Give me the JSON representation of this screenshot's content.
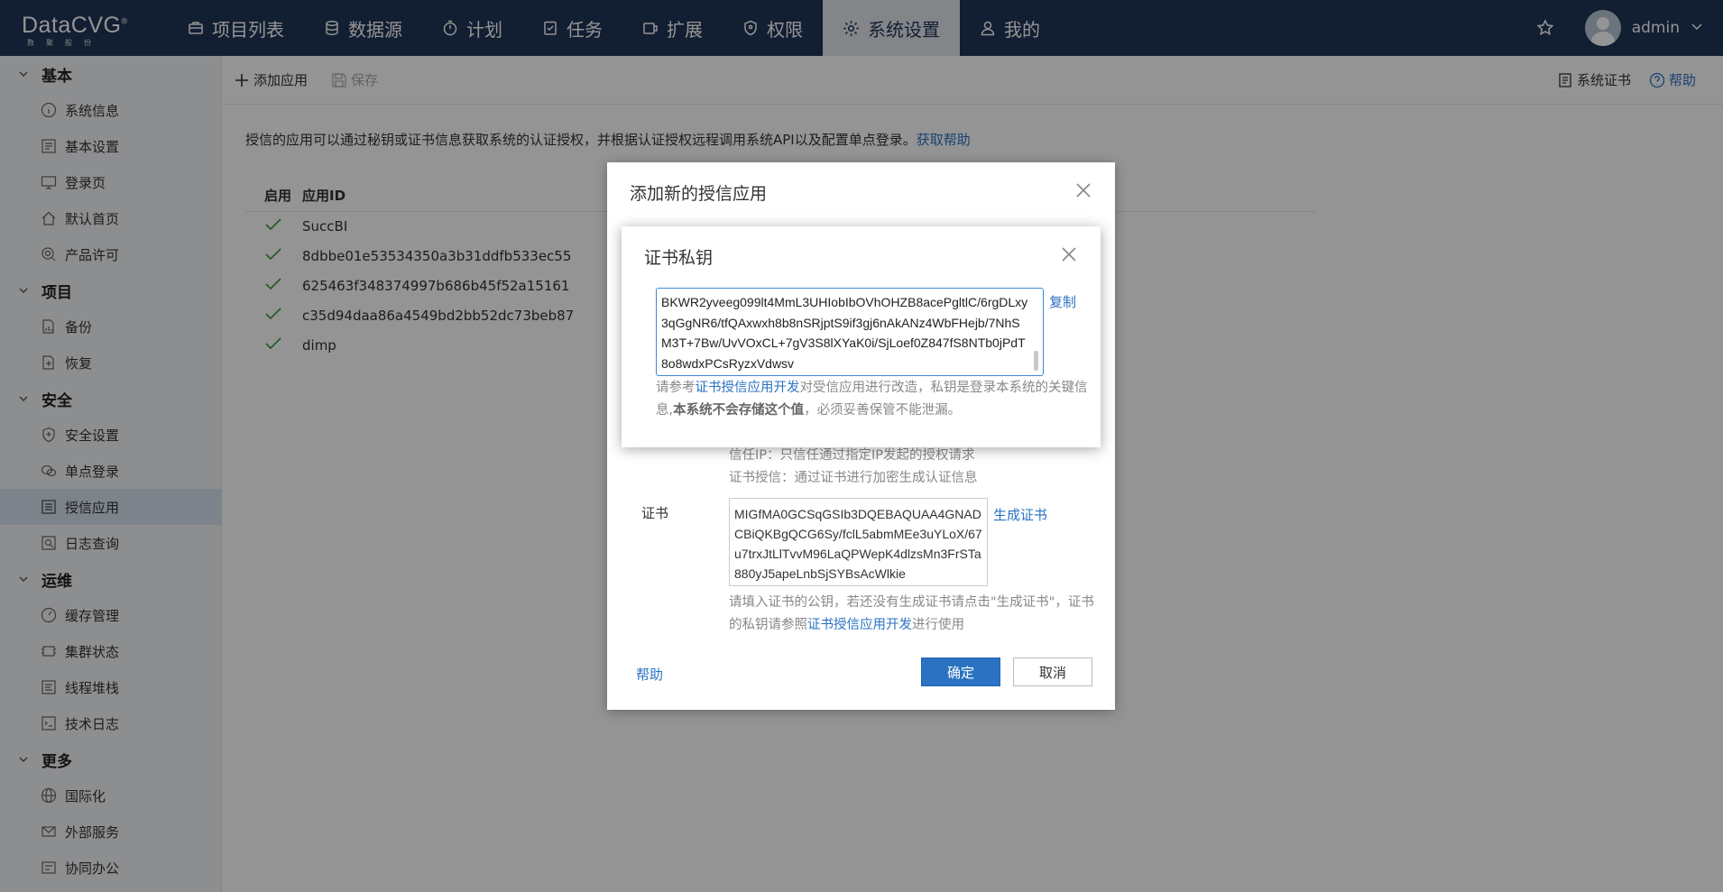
{
  "app": {
    "logo_name": "DataCVG",
    "logo_registered": "®",
    "logo_sub": "数聚股份",
    "username": "admin"
  },
  "nav": [
    {
      "label": "项目列表",
      "icon": "briefcase-icon"
    },
    {
      "label": "数据源",
      "icon": "database-icon"
    },
    {
      "label": "计划",
      "icon": "timer-icon"
    },
    {
      "label": "任务",
      "icon": "task-icon"
    },
    {
      "label": "扩展",
      "icon": "extension-icon"
    },
    {
      "label": "权限",
      "icon": "shield-icon"
    },
    {
      "label": "系统设置",
      "icon": "gear-icon",
      "active": true
    },
    {
      "label": "我的",
      "icon": "user-icon"
    }
  ],
  "sidebar": {
    "groups": [
      {
        "label": "基本",
        "items": [
          "系统信息",
          "基本设置",
          "登录页",
          "默认首页",
          "产品许可"
        ]
      },
      {
        "label": "项目",
        "items": [
          "备份",
          "恢复"
        ]
      },
      {
        "label": "安全",
        "items": [
          "安全设置",
          "单点登录",
          "授信应用",
          "日志查询"
        ]
      },
      {
        "label": "运维",
        "items": [
          "缓存管理",
          "集群状态",
          "线程堆栈",
          "技术日志"
        ]
      },
      {
        "label": "更多",
        "items": [
          "国际化",
          "外部服务",
          "协同办公"
        ]
      }
    ],
    "active_item": "授信应用"
  },
  "toolbar": {
    "add_label": "添加应用",
    "save_label": "保存",
    "cert_label": "系统证书",
    "help_label": "帮助"
  },
  "main": {
    "description": "授信的应用可以通过秘钥或证书信息获取系统的认证授权，并根据认证授权远程调用系统API以及配置单点登录。",
    "description_link": "获取帮助",
    "table": {
      "headers": [
        "启用",
        "应用ID"
      ],
      "rows": [
        {
          "enabled": true,
          "id": "SuccBI"
        },
        {
          "enabled": true,
          "id": "8dbbe01e53534350a3b31ddfb533ec55"
        },
        {
          "enabled": true,
          "id": "625463f348374997b686b45f52a15161"
        },
        {
          "enabled": true,
          "id": "c35d94daa86a4549bd2bb52dc73beb87"
        },
        {
          "enabled": true,
          "id": "dimp"
        }
      ]
    }
  },
  "dialog_add": {
    "title": "添加新的授信应用",
    "hint_ip": "信任IP：只信任通过指定IP发起的授权请求",
    "hint_cert": "证书授信：通过证书进行加密生成认证信息",
    "cert_label": "证书",
    "cert_value": "MIGfMA0GCSqGSIb3DQEBAQUAA4GNADCBiQKBgQCG6Sy/fclL5abmMEe3uYLoX/67u7trxJtLlTvvM96LaQPWepK4dlzsMn3FrSTa880yJ5apeLnbSjSYBsAcWlkie",
    "generate_cert": "生成证书",
    "cert_hint_prefix": "请填入证书的公钥，若还没有生成证书请点击\"生成证书\"，证书的私钥请参照",
    "cert_hint_link": "证书授信应用开发",
    "cert_hint_suffix": "进行使用",
    "help": "帮助",
    "ok": "确定",
    "cancel": "取消"
  },
  "dialog_key": {
    "title": "证书私钥",
    "key_value": "BKWR2yveeg099lt4MmL3UHIobIbOVhOHZB8acePgltlC/6rgDLxy3qGgNR6/tfQAxwxh8b8nSRjptS9if3gj6nAkANz4WbFHejb/7NhSM3T+7Bw/UvVOxCL+7gV3S8lXYaK0i/SjLoef0Z847fS8NTb0jPdT8o8wdxPCsRyzxVdwsv",
    "copy": "复制",
    "hint_prefix": "请参考",
    "hint_link": "证书授信应用开发",
    "hint_middle": "对受信应用进行改造，私钥是登录本系统的关键信息,",
    "hint_bold": "本系统不会存储这个值",
    "hint_suffix": "，必须妥善保管不能泄漏。"
  },
  "colors": {
    "topbar": "#1f3557",
    "accent": "#2b72c2",
    "check": "#3a9b3a"
  }
}
